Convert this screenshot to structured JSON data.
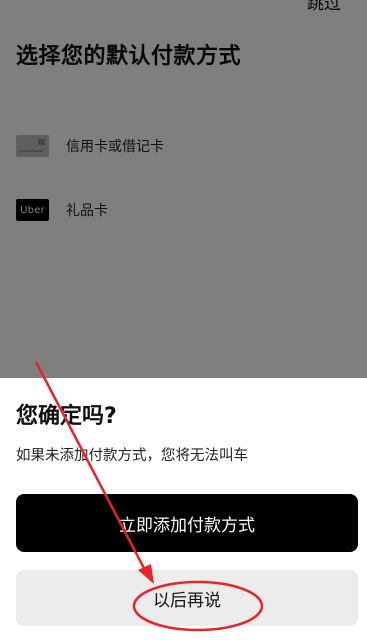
{
  "header": {
    "skip_label": "跳过",
    "title": "选择您的默认付款方式"
  },
  "payment_methods": [
    {
      "icon": "credit-card-icon",
      "label": "信用卡或借记卡"
    },
    {
      "icon": "uber-gift-card-icon",
      "icon_text": "Uber",
      "label": "礼品卡"
    }
  ],
  "dialog": {
    "title": "您确定吗?",
    "message": "如果未添加付款方式，您将无法叫车",
    "primary_button": "立即添加付款方式",
    "secondary_button": "以后再说"
  },
  "colors": {
    "primary_button_bg": "#000000",
    "secondary_button_bg": "#ececec",
    "annotation": "#e8232a"
  }
}
